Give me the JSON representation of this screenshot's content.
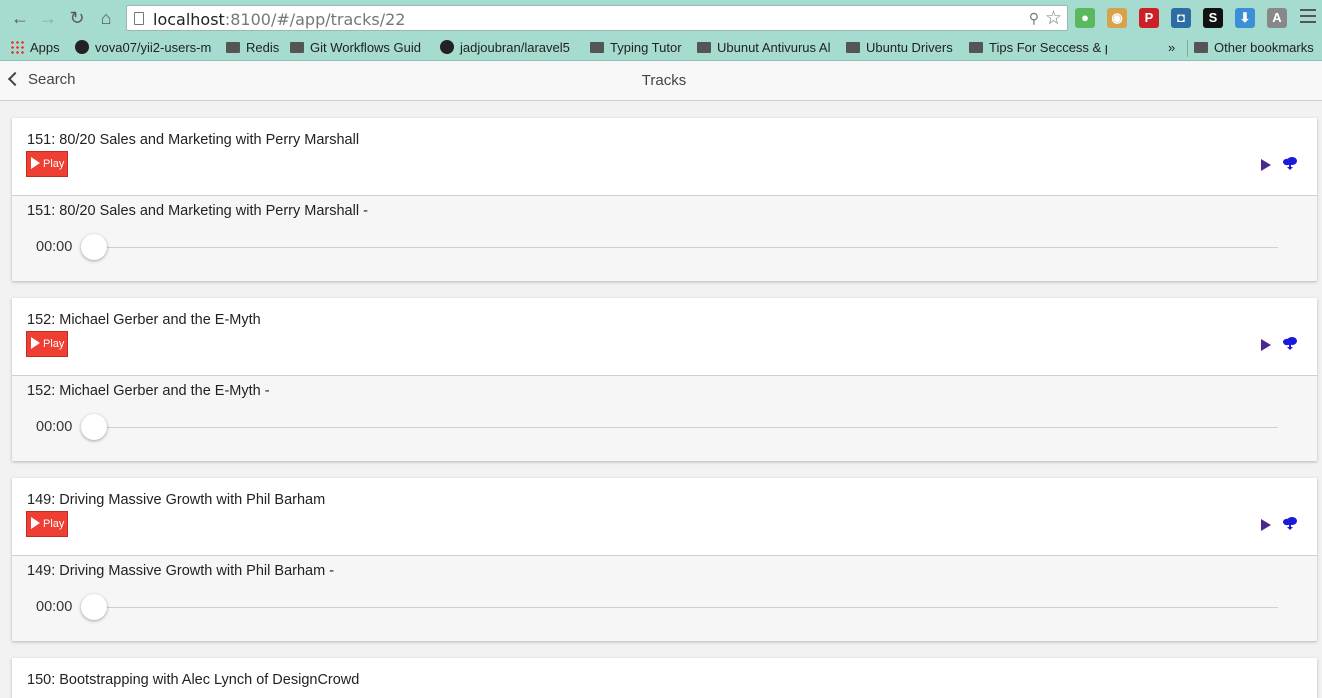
{
  "browser": {
    "url_host": "localhost",
    "url_rest": ":8100/#/app/tracks/22",
    "bookmarks": [
      {
        "label": "Apps",
        "icon": "apps-grid-icon"
      },
      {
        "label": "vova07/yii2-users-m",
        "icon": "github-icon"
      },
      {
        "label": "Redis",
        "icon": "folder-icon"
      },
      {
        "label": "Git Workflows Guid",
        "icon": "folder-icon"
      },
      {
        "label": "jadjoubran/laravel5",
        "icon": "github-icon"
      },
      {
        "label": "Typing Tutor",
        "icon": "folder-icon"
      },
      {
        "label": "Ubunut Antivurus Al",
        "icon": "folder-icon"
      },
      {
        "label": "Ubuntu Drivers",
        "icon": "folder-icon"
      },
      {
        "label": "Tips For Seccess & p",
        "icon": "folder-icon"
      }
    ],
    "overflow_label": "»",
    "other_bookmarks": "Other bookmarks",
    "extensions": [
      {
        "name": "evernote-icon",
        "glyph": "●",
        "color": "#5cb85c"
      },
      {
        "name": "cookie-icon",
        "glyph": "◉",
        "color": "#d6a24a"
      },
      {
        "name": "pinterest-icon",
        "glyph": "P",
        "color": "#cb2027"
      },
      {
        "name": "extension-icon",
        "glyph": "◘",
        "color": "#2e6da4"
      },
      {
        "name": "s-extension-icon",
        "glyph": "S",
        "color": "#111111"
      },
      {
        "name": "download-icon",
        "glyph": "⬇",
        "color": "#3a8fd6"
      },
      {
        "name": "angular-icon",
        "glyph": "A",
        "color": "#888888"
      }
    ]
  },
  "header": {
    "back_label": "Search",
    "title": "Tracks"
  },
  "tracks": [
    {
      "title": "151: 80/20 Sales and Marketing with Perry Marshall",
      "play_label": "Play",
      "player_title": "151: 80/20 Sales and Marketing with Perry Marshall -",
      "time": "00:00",
      "progress": 0
    },
    {
      "title": "152: Michael Gerber and the E-Myth",
      "play_label": "Play",
      "player_title": "152: Michael Gerber and the E-Myth -",
      "time": "00:00",
      "progress": 0
    },
    {
      "title": "149: Driving Massive Growth with Phil Barham",
      "play_label": "Play",
      "player_title": "149: Driving Massive Growth with Phil Barham -",
      "time": "00:00",
      "progress": 0
    },
    {
      "title": "150: Bootstrapping with Alec Lynch of DesignCrowd"
    }
  ],
  "colors": {
    "chrome": "#a6dbcf",
    "play_button": "#ef3f32",
    "small_play": "#4a2a8a",
    "cloud": "#1a1adb"
  }
}
